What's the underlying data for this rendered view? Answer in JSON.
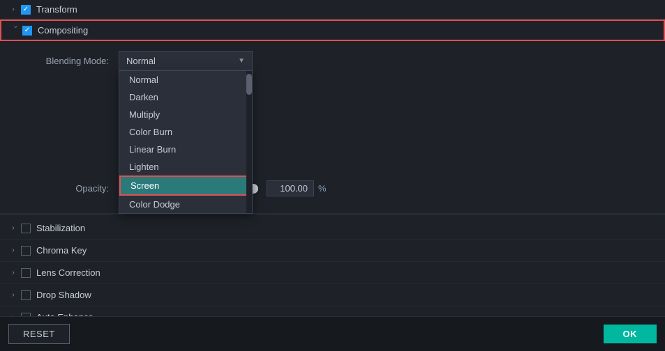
{
  "sections": {
    "transform": {
      "label": "Transform",
      "chevron": "›",
      "checked": true
    },
    "compositing": {
      "label": "Compositing",
      "checked": true,
      "blending_mode_label": "Blending Mode:",
      "opacity_label": "Opacity:",
      "selected_mode": "Normal",
      "opacity_value": "100.00",
      "percent": "%",
      "dropdown_items": [
        {
          "label": "Normal",
          "active": false
        },
        {
          "label": "Darken",
          "active": false
        },
        {
          "label": "Multiply",
          "active": false
        },
        {
          "label": "Color Burn",
          "active": false
        },
        {
          "label": "Linear Burn",
          "active": false
        },
        {
          "label": "Lighten",
          "active": false
        },
        {
          "label": "Screen",
          "active": true
        },
        {
          "label": "Color Dodge",
          "active": false
        }
      ]
    },
    "other_items": [
      {
        "label": "Stabilization",
        "checked": false
      },
      {
        "label": "Chroma Key",
        "checked": false
      },
      {
        "label": "Lens Correction",
        "checked": false
      },
      {
        "label": "Drop Shadow",
        "checked": false
      },
      {
        "label": "Auto Enhance",
        "checked": false
      }
    ]
  },
  "footer": {
    "reset_label": "RESET",
    "ok_label": "OK"
  }
}
